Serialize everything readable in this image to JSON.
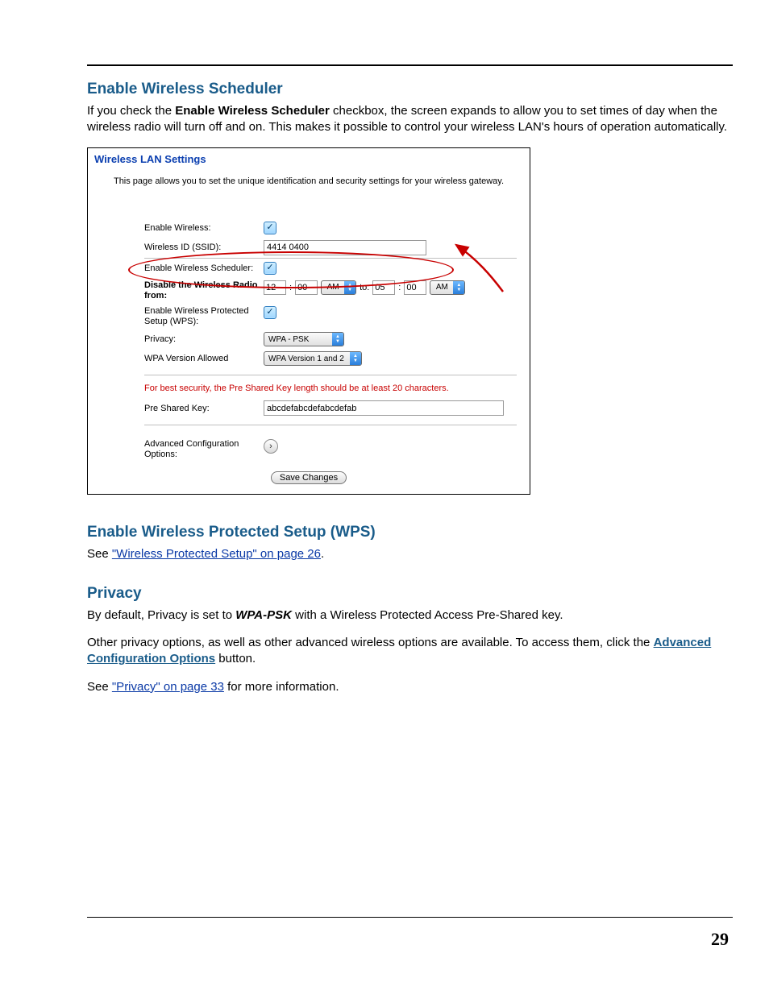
{
  "sec1": {
    "heading": "Enable Wireless Scheduler",
    "para_pre": "If you check the ",
    "para_bold": "Enable Wireless Scheduler",
    "para_post": " checkbox, the screen expands to allow you to set times of day when the wireless radio will turn off and on. This makes it possible to control your wireless LAN's hours of operation automatically."
  },
  "panel": {
    "title": "Wireless LAN Settings",
    "subtitle": "This page allows you to set the unique identification and security settings for your wireless gateway.",
    "rows": {
      "enable_wireless": "Enable Wireless:",
      "ssid_label": "Wireless ID (SSID):",
      "ssid_value": "4414 0400",
      "sched_label": "Enable Wireless Scheduler:",
      "disable_label": "Disable the Wireless Radio from:",
      "from_h": "12",
      "from_m": "00",
      "ampm1": "AM",
      "to_text": "to:",
      "to_h": "05",
      "to_m": "00",
      "ampm2": "AM",
      "wps_label": "Enable Wireless Protected Setup (WPS):",
      "privacy_label": "Privacy:",
      "privacy_value": "WPA - PSK",
      "wpa_ver_label": "WPA Version Allowed",
      "wpa_ver_value": "WPA Version 1 and 2",
      "warn": "For best security, the Pre Shared Key length should be at least 20 characters.",
      "psk_label": "Pre Shared Key:",
      "psk_value": "abcdefabcdefabcdefab",
      "adv_label": "Advanced Configuration Options:",
      "save": "Save Changes"
    }
  },
  "sec2": {
    "heading": "Enable Wireless Protected Setup (WPS)",
    "see": "See ",
    "link": "\"Wireless Protected Setup\" on page 26",
    "after": "."
  },
  "sec3": {
    "heading": "Privacy",
    "p1_pre": "By default, Privacy is set to ",
    "p1_bold": "WPA-PSK",
    "p1_post": " with a Wireless Protected Access Pre-Shared key.",
    "p2_pre": "Other privacy options, as well as other advanced wireless options are available. To access them, click the ",
    "p2_link": "Advanced Configuration Options",
    "p2_post": " button.",
    "p3_pre": "See ",
    "p3_link": "\"Privacy\" on page 33",
    "p3_post": " for more information."
  },
  "page_number": "29"
}
